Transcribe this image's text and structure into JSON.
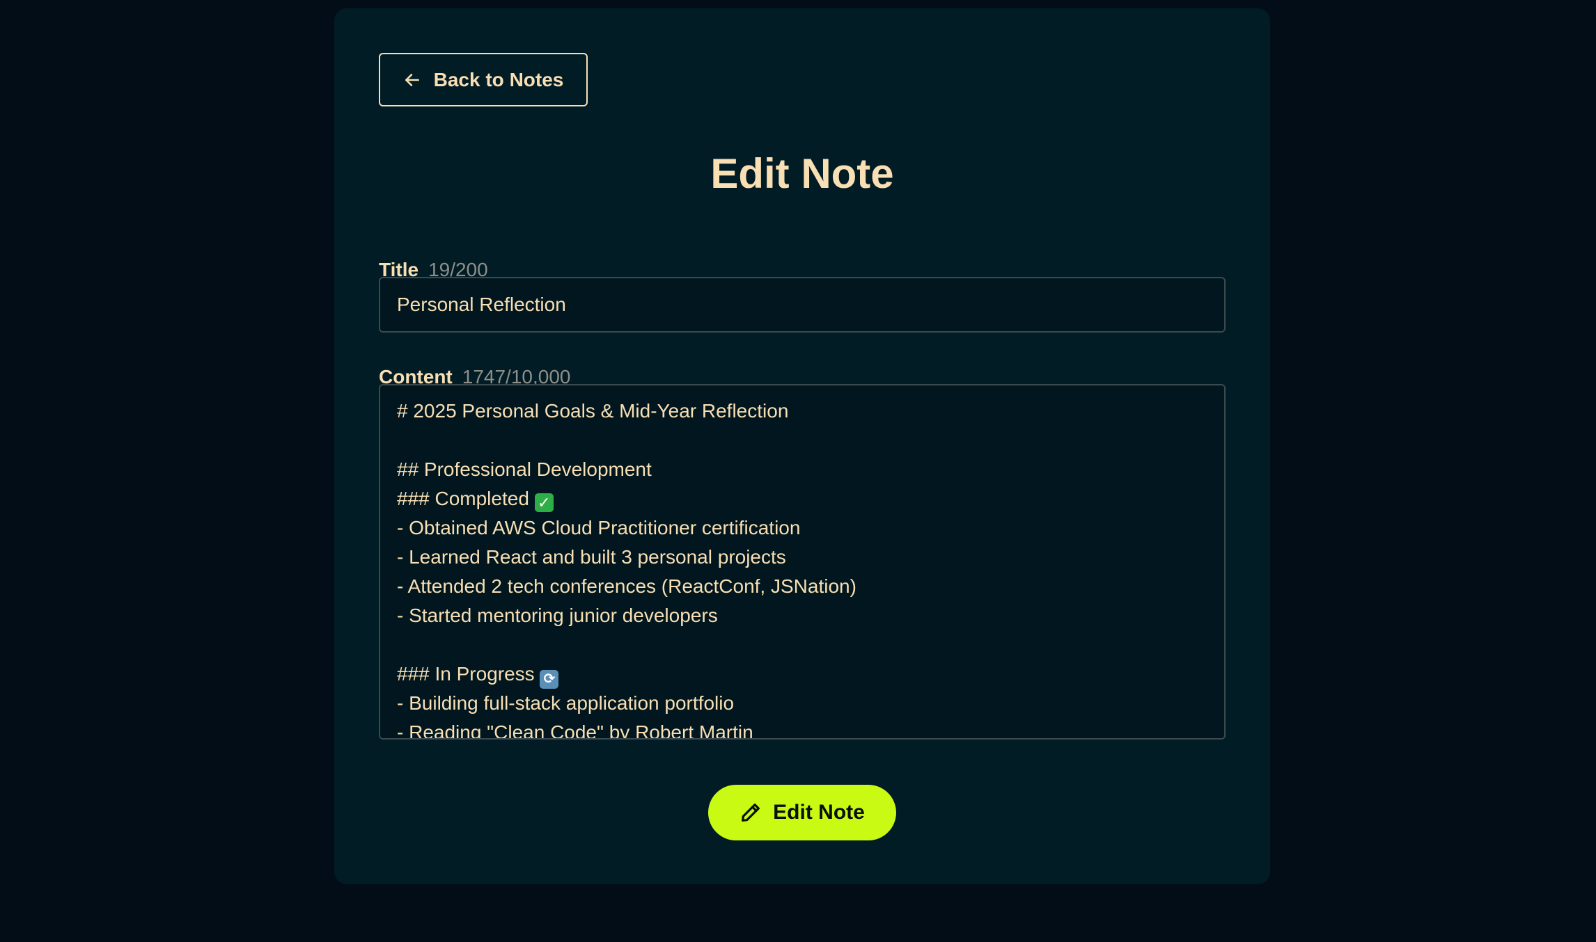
{
  "back_button": {
    "label": "Back to Notes",
    "icon": "arrow-left-icon"
  },
  "page_title": "Edit Note",
  "title_field": {
    "label": "Title",
    "counter": "19/200",
    "value": "Personal Reflection"
  },
  "content_field": {
    "label": "Content",
    "counter": "1747/10,000",
    "lines": [
      "# 2025 Personal Goals & Mid-Year Reflection",
      "",
      "## Professional Development",
      "### Completed ",
      "- Obtained AWS Cloud Practitioner certification",
      "- Learned React and built 3 personal projects",
      "- Attended 2 tech conferences (ReactConf, JSNation)",
      "- Started mentoring junior developers",
      "",
      "### In Progress ",
      "- Building full-stack application portfolio",
      "- Reading \"Clean Code\" by Robert Martin"
    ],
    "emojis": {
      "completed": "✓",
      "in_progress": "⟳"
    }
  },
  "submit_button": {
    "label": "Edit Note",
    "icon": "pencil-icon"
  },
  "colors": {
    "page_background": "#020d17",
    "card_background": "#021c26",
    "text_accent": "#f8dfb4",
    "counter_text": "#8e8f88",
    "button_accent": "#c8fa14"
  }
}
